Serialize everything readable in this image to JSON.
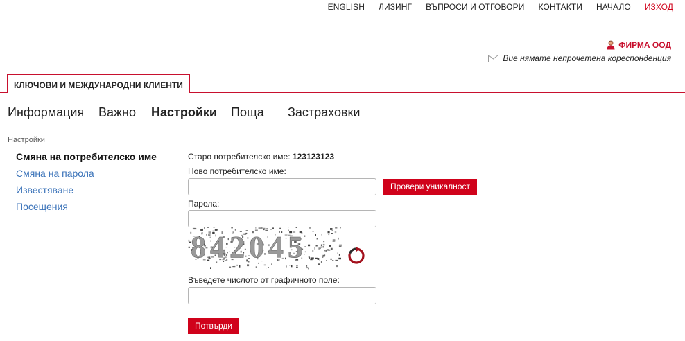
{
  "topnav": [
    {
      "label": "ENGLISH"
    },
    {
      "label": "ЛИЗИНГ"
    },
    {
      "label": "ВЪПРОСИ И ОТГОВОРИ"
    },
    {
      "label": "КОНТАКТИ"
    },
    {
      "label": "НАЧАЛО"
    },
    {
      "label": "ИЗХОД"
    }
  ],
  "account": {
    "company": "ФИРМА ООД",
    "mail_status": "Вие нямате непрочетена кореспонденция"
  },
  "tab": {
    "label": "КЛЮЧОВИ И МЕЖДУНАРОДНИ КЛИЕНТИ"
  },
  "subnav": [
    {
      "label": "Информация"
    },
    {
      "label": "Важно"
    },
    {
      "label": "Настройки",
      "active": true
    },
    {
      "label": "Поща"
    },
    {
      "label": "Застраховки"
    }
  ],
  "breadcrumb": "Настройки",
  "sidemenu": [
    {
      "label": "Смяна на потребителско име",
      "current": true
    },
    {
      "label": "Смяна на парола"
    },
    {
      "label": "Известяване"
    },
    {
      "label": "Посещения"
    }
  ],
  "form": {
    "old_username_label": "Старо потребителско име:",
    "old_username_value": "123123123",
    "new_username_label": "Ново потребителско име:",
    "new_username_value": "",
    "check_button": "Провери уникалност",
    "password_label": "Парола:",
    "password_value": "",
    "captcha_text": "842045",
    "captcha_label": "Въведете числото от графичното поле:",
    "captcha_value": "",
    "submit_button": "Потвърди"
  },
  "colors": {
    "accent": "#c8102e",
    "link": "#3b73b9",
    "button": "#d0021b"
  },
  "icons": {
    "company": "user-icon",
    "mail": "envelope-icon",
    "refresh": "refresh-icon"
  }
}
